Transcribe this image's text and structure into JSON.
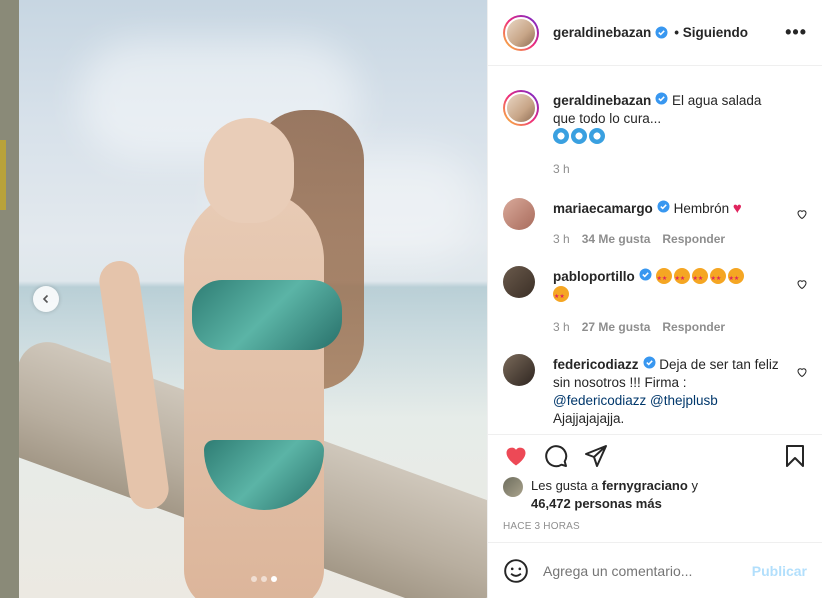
{
  "post": {
    "username": "geraldinebazan",
    "follow_status": "• Siguiendo",
    "more_icon": "more-icon",
    "caption": "El agua salada que todo lo cura...",
    "caption_time": "3 h"
  },
  "comments": [
    {
      "username": "mariaecamargo",
      "text": "Hembrón",
      "time": "3 h",
      "likes": "34 Me gusta",
      "reply": "Responder"
    },
    {
      "username": "pabloportillo",
      "text": "",
      "time": "3 h",
      "likes": "27 Me gusta",
      "reply": "Responder"
    },
    {
      "username": "federicodiazz",
      "text": "Deja de ser tan feliz sin nosotros !!! Firma :",
      "mention1": "@federicodiazz",
      "mention2": "@thejplusb",
      "text_end": "Ajajjajajajja."
    }
  ],
  "engagement": {
    "liked_by_prefix": "Les gusta a",
    "liked_by_user": "fernygraciano",
    "liked_by_y": "y",
    "liked_by_count": "46,472 personas más",
    "timestamp": "HACE 3 HORAS"
  },
  "composer": {
    "placeholder": "Agrega un comentario...",
    "post_label": "Publicar"
  },
  "carousel": {
    "count": 3,
    "active": 3
  },
  "colors": {
    "like_red": "#ed4956",
    "verified_blue": "#3897f0",
    "post_disabled": "#b2dffc"
  }
}
